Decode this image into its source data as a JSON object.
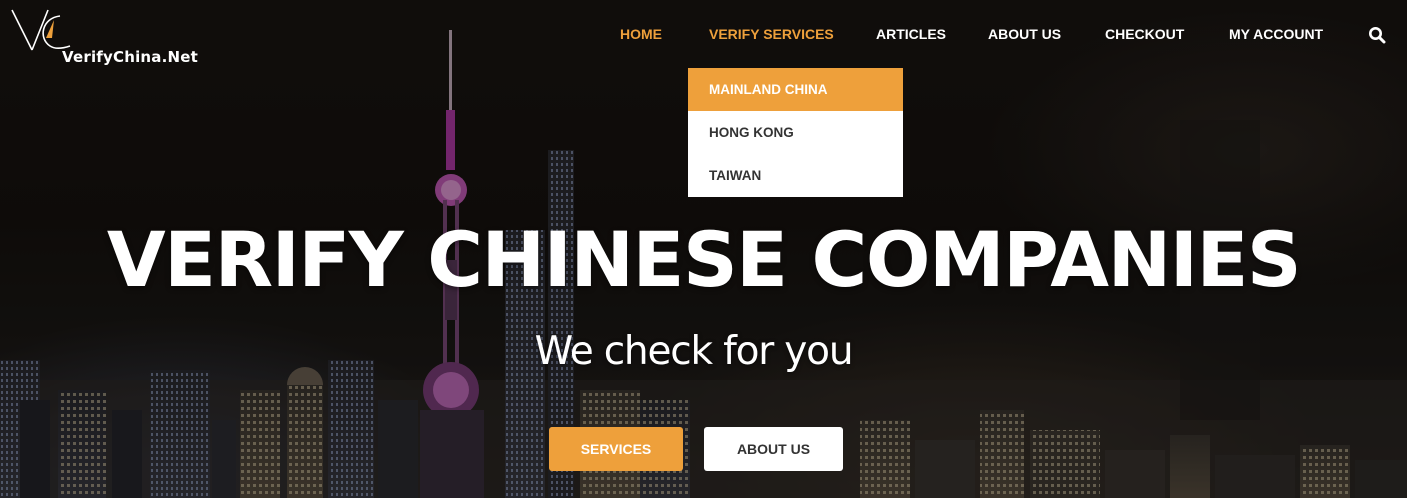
{
  "brand": {
    "name": "VerifyChina.Net",
    "accent_color": "#eea03b"
  },
  "nav": {
    "items": [
      {
        "label": "HOME",
        "active": true
      },
      {
        "label": "VERIFY SERVICES",
        "active": true
      },
      {
        "label": "ARTICLES",
        "active": false
      },
      {
        "label": "ABOUT US",
        "active": false
      },
      {
        "label": "CHECKOUT",
        "active": false
      },
      {
        "label": "MY ACCOUNT",
        "active": false
      }
    ],
    "search_icon": "search-icon"
  },
  "dropdown": {
    "items": [
      {
        "label": "MAINLAND CHINA",
        "highlighted": true
      },
      {
        "label": "HONG KONG",
        "highlighted": false
      },
      {
        "label": "TAIWAN",
        "highlighted": false
      }
    ]
  },
  "hero": {
    "headline": "VERIFY CHINESE COMPANIES",
    "subheadline": "We check for you",
    "buttons": {
      "services": "SERVICES",
      "about": "ABOUT US"
    }
  }
}
